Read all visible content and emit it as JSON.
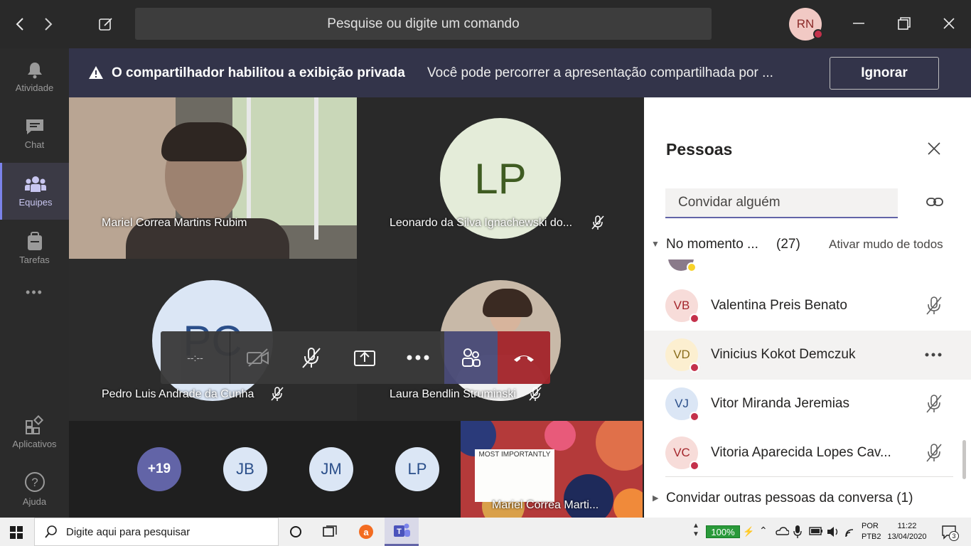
{
  "titlebar": {
    "search_placeholder": "Pesquise ou digite um comando",
    "user_initials": "RN"
  },
  "appbar": {
    "items": [
      {
        "label": "Atividade",
        "icon": "bell-icon"
      },
      {
        "label": "Chat",
        "icon": "chat-icon"
      },
      {
        "label": "Equipes",
        "icon": "teams-icon"
      },
      {
        "label": "Tarefas",
        "icon": "assignments-icon"
      },
      {
        "label": "Aplicativos",
        "icon": "apps-icon"
      },
      {
        "label": "Ajuda",
        "icon": "help-icon"
      }
    ],
    "more": "•••"
  },
  "banner": {
    "title": "O compartilhador habilitou a exibição privada",
    "message": "Você pode percorrer a apresentação compartilhada por ...",
    "ignore_label": "Ignorar"
  },
  "stage": {
    "tiles": [
      {
        "name": "Mariel Correa Martins Rubim"
      },
      {
        "name": "Leonardo da Silva Ignachewski do...",
        "initials": "LP"
      },
      {
        "name": "Pedro Luis Andrade da Cunha",
        "initials": "PC"
      },
      {
        "name": "Laura Bendlin Struminski"
      }
    ],
    "bottom_avatars": [
      "+19",
      "JB",
      "JM",
      "LP"
    ],
    "shared_tile": {
      "name": "Mariel Correa Marti...",
      "slide_title": "MOST IMPORTANTLY"
    },
    "timer": "--:--"
  },
  "people_panel": {
    "title": "Pessoas",
    "invite_placeholder": "Convidar alguém",
    "section_label": "No momento ...",
    "section_count": "(27)",
    "mute_all": "Ativar mudo de todos",
    "rows": [
      {
        "initials": "VB",
        "name": "Valentina Preis Benato",
        "bg": "#f7dcd9",
        "fg": "#a4262c"
      },
      {
        "initials": "VD",
        "name": "Vinicius Kokot Demczuk",
        "bg": "#fcefd0",
        "fg": "#8a6d1c"
      },
      {
        "initials": "VJ",
        "name": "Vitor Miranda Jeremias",
        "bg": "#dbe6f5",
        "fg": "#2b4f8a"
      },
      {
        "initials": "VC",
        "name": "Vitoria Aparecida Lopes Cav...",
        "bg": "#f7dcd9",
        "fg": "#a4262c"
      }
    ],
    "footer_invite": "Convidar outras pessoas da conversa (1)"
  },
  "taskbar": {
    "search_placeholder": "Digite aqui para pesquisar",
    "battery": "100%",
    "lang_top": "POR",
    "lang_bottom": "PTB2",
    "time": "11:22",
    "date": "13/04/2020",
    "notifications": "3"
  },
  "colors": {
    "accent": "#6264a7",
    "banner": "#33344a",
    "hangup": "#a4262c",
    "presence_busy": "#c4314b"
  }
}
